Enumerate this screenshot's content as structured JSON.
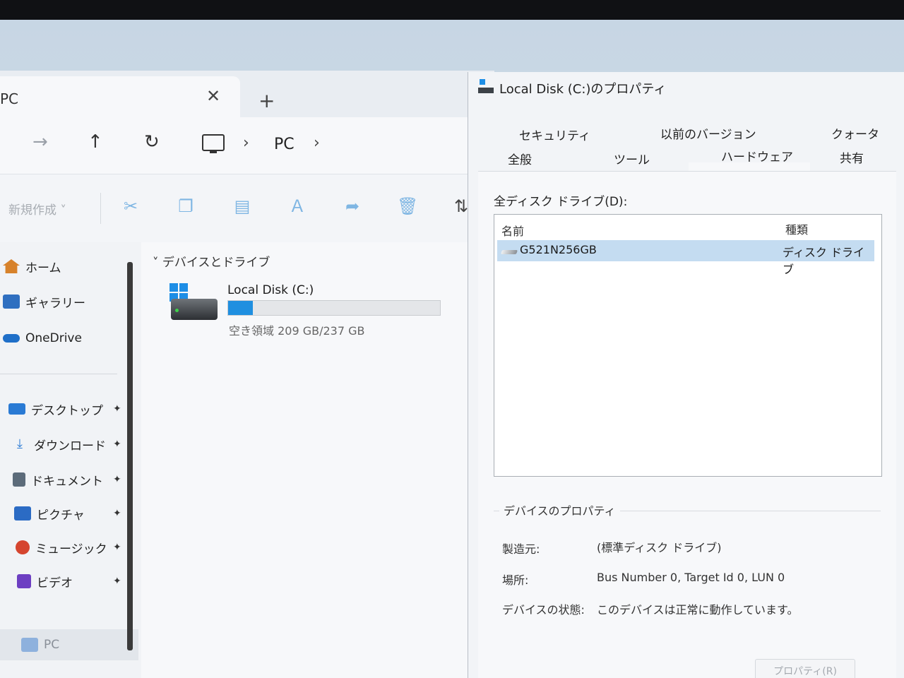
{
  "explorer": {
    "tab_title": "PC",
    "tab_close": "✕",
    "new_tab": "+",
    "nav": {
      "forward": "→",
      "up": "↑",
      "refresh": "↻",
      "chevron": "›",
      "breadcrumb_pc": "PC"
    },
    "toolbar": {
      "new_label": "新規作成 ˅",
      "sort": "⇅"
    },
    "sidebar": {
      "home": "ホーム",
      "gallery": "ギャラリー",
      "onedrive": "OneDrive",
      "desktop": "デスクトップ",
      "downloads": "ダウンロード",
      "documents": "ドキュメント",
      "pictures": "ピクチャ",
      "music": "ミュージック",
      "videos": "ビデオ",
      "pc": "PC",
      "pin": "✦"
    },
    "content": {
      "group_header": "デバイスとドライブ",
      "group_chevron": "˅",
      "drive_name": "Local Disk (C:)",
      "drive_free_text": "空き領域 209 GB/237 GB",
      "drive_used_fraction": 0.118
    }
  },
  "properties": {
    "title": "Local Disk (C:)のプロパティ",
    "tabs_row1": [
      "セキュリティ",
      "以前のバージョン",
      "クォータ"
    ],
    "tabs_row2": [
      "全般",
      "ツール",
      "ハードウェア",
      "共有"
    ],
    "selected_tab": "ハードウェア",
    "all_drives_label": "全ディスク ドライブ(D):",
    "list_columns": [
      "名前",
      "種類"
    ],
    "drives": [
      {
        "name": "G521N256GB",
        "type": "ディスク ドライブ"
      }
    ],
    "device_props_legend": "デバイスのプロパティ",
    "manufacturer_label": "製造元:",
    "manufacturer_value": "(標準ディスク ドライブ)",
    "location_label": "場所:",
    "location_value": "Bus Number 0, Target Id 0, LUN 0",
    "status_label": "デバイスの状態:",
    "status_value": "このデバイスは正常に動作しています。",
    "properties_button": "プロパティ(R)"
  },
  "colors": {
    "accent": "#1f8fe0",
    "selection": "#c4dcf1"
  }
}
